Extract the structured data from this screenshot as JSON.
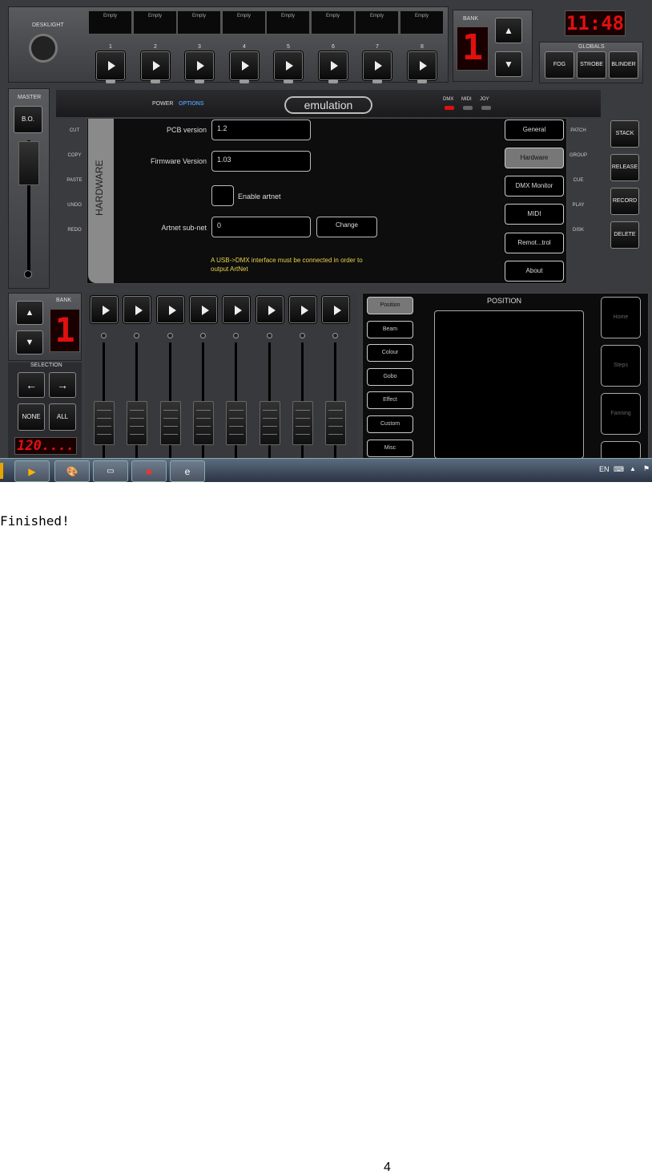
{
  "app": {
    "brand_logo": "emulation",
    "desklight_label": "DESKLIGHT",
    "bank_label": "BANK",
    "bank_value": "1",
    "clock": "11:48",
    "globals_label": "GLOBALS"
  },
  "top_slots": [
    "Empty",
    "Empty",
    "Empty",
    "Empty",
    "Empty",
    "Empty",
    "Empty",
    "Empty"
  ],
  "top_numbers": [
    "1",
    "2",
    "3",
    "4",
    "5",
    "6",
    "7",
    "8"
  ],
  "globals": [
    "FOG",
    "STROBE",
    "BLINDER"
  ],
  "master": {
    "label": "MASTER",
    "bo": "B.O."
  },
  "tabs": {
    "power": "POWER",
    "options": "OPTIONS"
  },
  "indicators": [
    "DMX",
    "MIDI",
    "JOY"
  ],
  "left_side": [
    "CUT",
    "COPY",
    "PASTE",
    "UNDO",
    "REDO"
  ],
  "right_side": [
    "PATCH",
    "GROUP",
    "CUE",
    "PLAY",
    "DISK"
  ],
  "panel_title": "HARDWARE",
  "hardware": {
    "pcb_label": "PCB version",
    "pcb_value": "1.2",
    "firmware_label": "Firmware Version",
    "firmware_value": "1.03",
    "artnet_enable_label": "Enable artnet",
    "artnet_subnet_label": "Artnet sub-net",
    "artnet_subnet_value": "0",
    "change_label": "Change",
    "note_line1": "A USB->DMX interface must be connected in order to",
    "note_line2": "output ArtNet"
  },
  "options_menu": [
    "General",
    "Hardware",
    "DMX Monitor",
    "MIDI",
    "Remot...trol",
    "About"
  ],
  "right_buttons": [
    "STACK",
    "RELEASE",
    "RECORD",
    "DELETE"
  ],
  "lower": {
    "bank_label": "BANK",
    "bank_value": "1",
    "selection_label": "SELECTION",
    "none_label": "NONE",
    "all_label": "ALL",
    "bpm_readout": "120...."
  },
  "categories": [
    "Position",
    "Beam",
    "Colour",
    "Gobo",
    "Effect",
    "Custom",
    "Misc"
  ],
  "position_title": "POSITION",
  "position_buttons": [
    "Home",
    "Steps",
    "Fanning"
  ],
  "taskbar": {
    "lang": "EN"
  },
  "caption": "Finished!",
  "page_number": "4",
  "colors": {
    "led_red": "#e01010",
    "note_yellow": "#e8d24a",
    "options_blue": "#4a8fe0"
  }
}
